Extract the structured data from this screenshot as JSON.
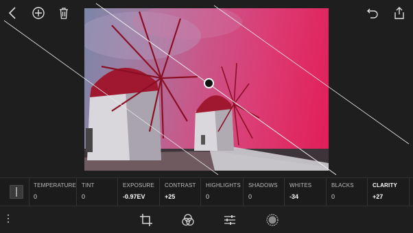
{
  "toolbar": {
    "left_icons": [
      "back-chevron-icon",
      "add-circle-icon",
      "trash-icon"
    ],
    "right_icons": [
      "undo-icon",
      "share-icon"
    ]
  },
  "adjustments": [
    {
      "label": "TEMPERATURE",
      "value": "0"
    },
    {
      "label": "TINT",
      "value": "0"
    },
    {
      "label": "EXPOSURE",
      "value": "-0.97EV"
    },
    {
      "label": "CONTRAST",
      "value": "+25"
    },
    {
      "label": "HIGHLIGHTS",
      "value": "0"
    },
    {
      "label": "SHADOWS",
      "value": "0"
    },
    {
      "label": "WHITES",
      "value": "-34"
    },
    {
      "label": "BLACKS",
      "value": "0"
    },
    {
      "label": "CLARITY",
      "value": "+27"
    }
  ],
  "active_adjustment": "CLARITY",
  "bottom_tools": [
    "crop-icon",
    "color-mix-icon",
    "sliders-icon",
    "selective-tool-icon"
  ],
  "colors": {
    "background": "#1e1e1e",
    "filter_tint": "#e21c57",
    "sky": "#7b86a8"
  }
}
